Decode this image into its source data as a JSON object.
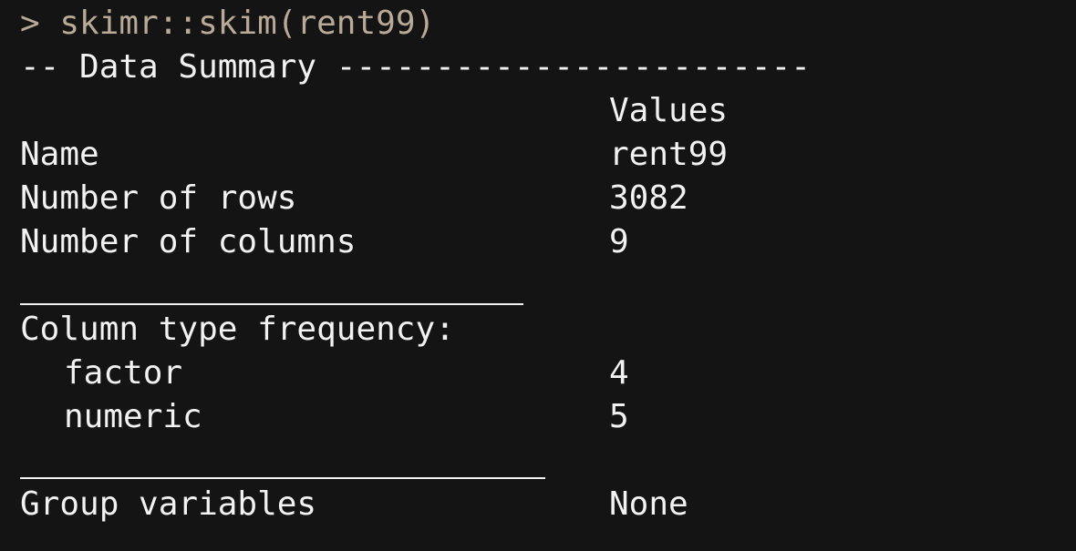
{
  "console": {
    "prompt": ">",
    "command": "skimr::skim(rent99)",
    "header": "-- Data Summary ------------------------"
  },
  "summary": {
    "values_header": "Values",
    "rows": [
      {
        "label": "Name",
        "value": "rent99"
      },
      {
        "label": "Number of rows",
        "value": "3082"
      },
      {
        "label": "Number of columns",
        "value": "9"
      }
    ]
  },
  "column_types": {
    "title": "Column type frequency:",
    "rows": [
      {
        "label": "factor",
        "value": "4"
      },
      {
        "label": "numeric",
        "value": "5"
      }
    ]
  },
  "group": {
    "label": "Group variables",
    "value": "None"
  },
  "colors": {
    "background": "#141414",
    "text": "#f2f2f2",
    "command": "#b9aa97"
  }
}
